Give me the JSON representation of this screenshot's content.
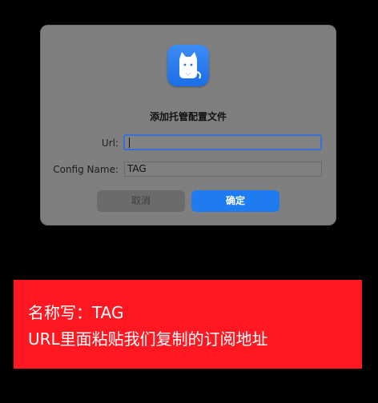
{
  "dialog": {
    "title": "添加托管配置文件",
    "app_icon": "cat-icon",
    "url_label": "Url:",
    "url_value": "",
    "config_label": "Config Name:",
    "config_value": "TAG",
    "cancel_label": "取消",
    "ok_label": "确定"
  },
  "annotation": {
    "line1": "名称写：TAG",
    "line2": "URL里面粘贴我们复制的订阅地址"
  },
  "colors": {
    "accent": "#1f7cf0",
    "banner": "#ff1721",
    "dialog_bg": "#7f7f7f"
  }
}
